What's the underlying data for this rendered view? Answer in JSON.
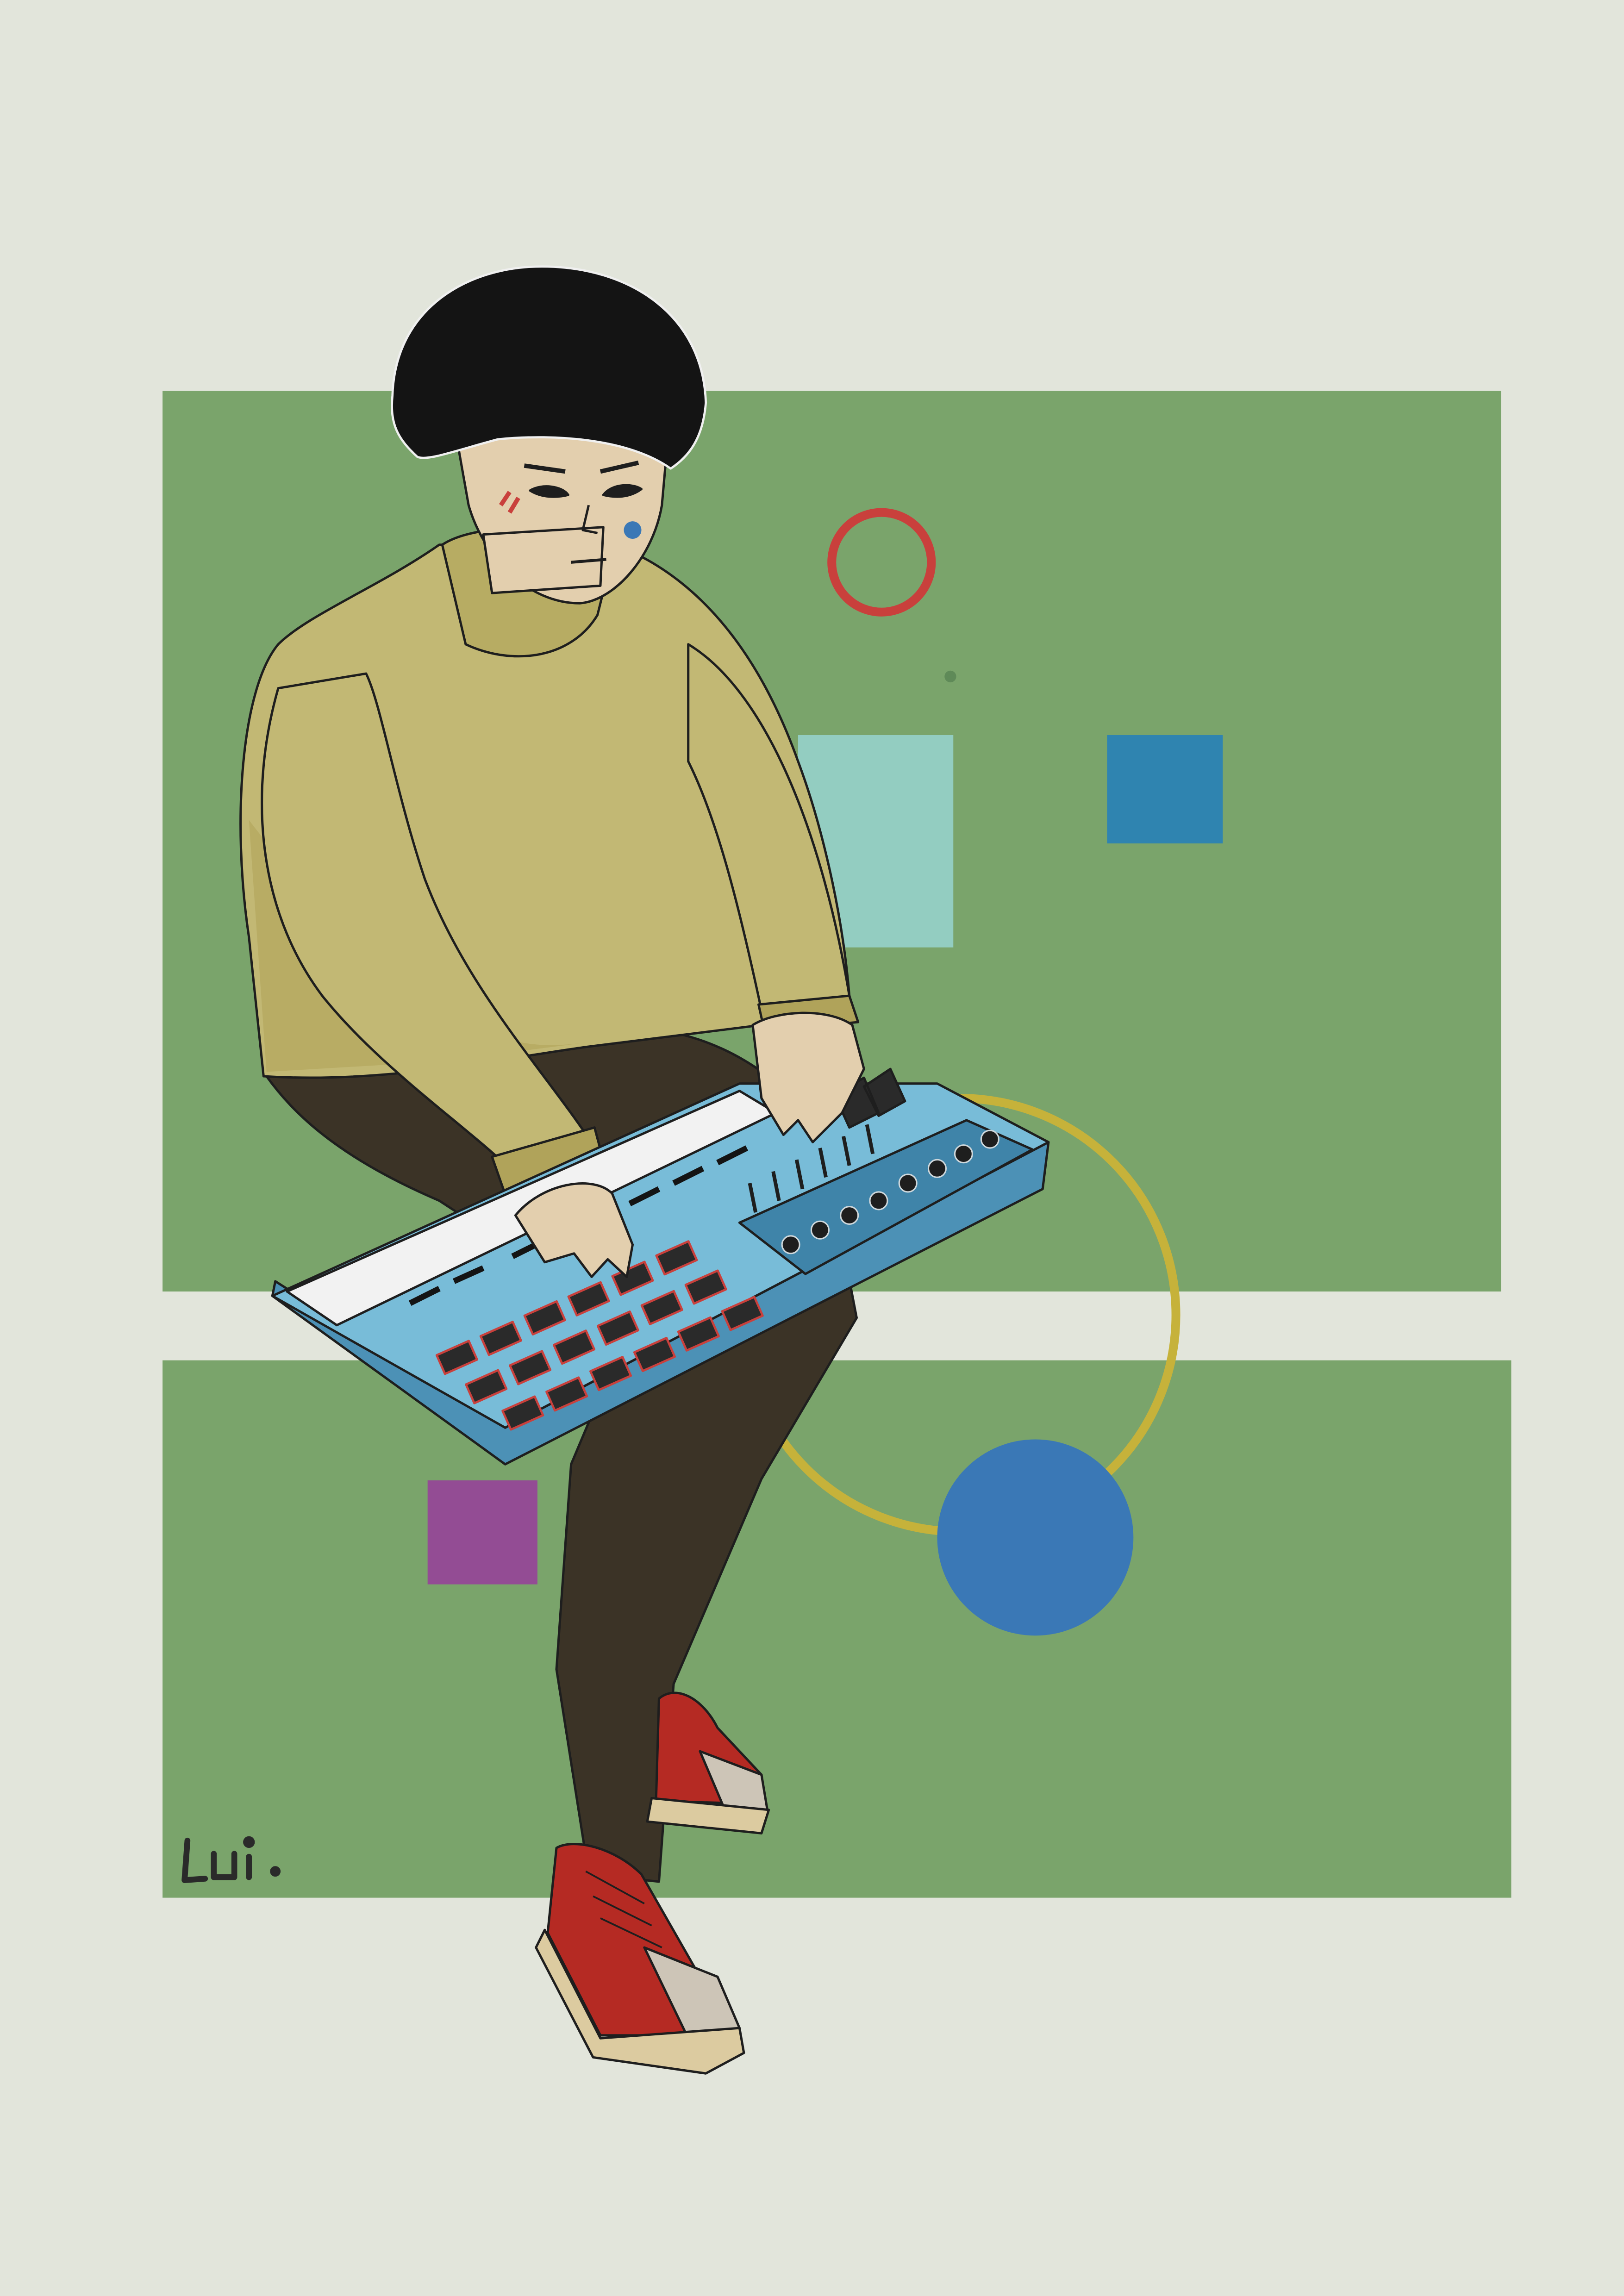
{
  "artwork": {
    "signature": "Lui.",
    "subject": "person-playing-midi-keyboard-controller"
  },
  "palette": {
    "background": "#e2e5db",
    "panel_green": "#7aa46b",
    "ring_red": "#c9403c",
    "ring_gold": "#c6b23a",
    "square_mint": "#93cdc1",
    "square_teal": "#2f84b0",
    "square_purple": "#934c94",
    "disc_blue": "#3a78b6",
    "sweater": "#c2b874",
    "sweater_shadow": "#b0a35a",
    "pants": "#3b3326",
    "hair": "#141414",
    "skin": "#e3cfae",
    "keyboard_body": "#78bcd8",
    "keyboard_side": "#4c91b6",
    "keyboard_panel": "#3f84a9",
    "pad": "#2a2a2a",
    "pad_outline": "#c9403c",
    "shoe_red": "#b52a23",
    "shoe_toe": "#cdc5b7",
    "shoe_sole": "#dccba0",
    "ink": "#1e1e1e"
  }
}
